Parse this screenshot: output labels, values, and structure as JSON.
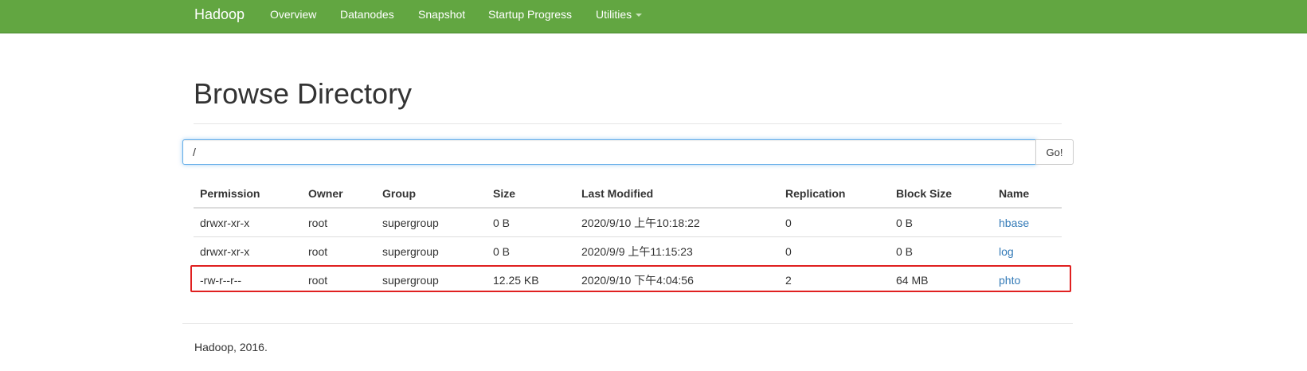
{
  "navbar": {
    "brand": "Hadoop",
    "links": [
      "Overview",
      "Datanodes",
      "Snapshot",
      "Startup Progress",
      "Utilities"
    ],
    "background_color": "#62a641"
  },
  "page": {
    "title": "Browse Directory"
  },
  "path_bar": {
    "value": "/",
    "go_label": "Go!"
  },
  "table": {
    "headers": [
      "Permission",
      "Owner",
      "Group",
      "Size",
      "Last Modified",
      "Replication",
      "Block Size",
      "Name"
    ],
    "rows": [
      {
        "permission": "drwxr-xr-x",
        "owner": "root",
        "group": "supergroup",
        "size": "0 B",
        "modified": "2020/9/10 上午10:18:22",
        "replication": "0",
        "block_size": "0 B",
        "name": "hbase"
      },
      {
        "permission": "drwxr-xr-x",
        "owner": "root",
        "group": "supergroup",
        "size": "0 B",
        "modified": "2020/9/9 上午11:15:23",
        "replication": "0",
        "block_size": "0 B",
        "name": "log"
      },
      {
        "permission": "-rw-r--r--",
        "owner": "root",
        "group": "supergroup",
        "size": "12.25 KB",
        "modified": "2020/9/10 下午4:04:56",
        "replication": "2",
        "block_size": "64 MB",
        "name": "phto"
      }
    ],
    "highlight_color": "#e02020"
  },
  "footer": {
    "text": "Hadoop, 2016."
  }
}
